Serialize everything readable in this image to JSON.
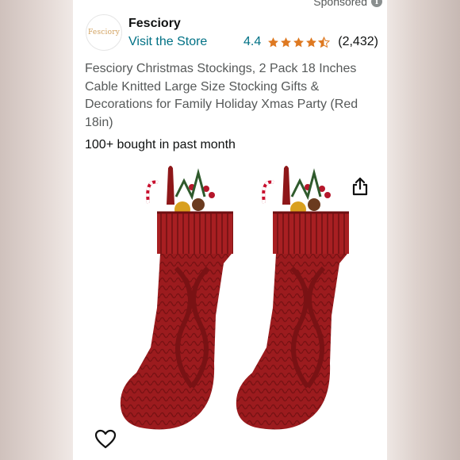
{
  "sponsored": {
    "label": "Sponsored",
    "info_icon": "info-icon"
  },
  "store": {
    "logo_text": "Fesciory",
    "brand_name": "Fesciory",
    "visit_label": "Visit the Store"
  },
  "rating": {
    "value": "4.4",
    "stars": 4.4,
    "star_color": "#de7921",
    "count": "(2,432)"
  },
  "product": {
    "title": "Fesciory Christmas Stockings, 2 Pack 18 Inches Cable Knitted Large Size Stocking Gifts & Decorations for Family Holiday Xmas Party (Red 18in)",
    "bought": "100+ bought in past month",
    "image_icon": "red-knit-stockings-image",
    "color": "#9c1b1e"
  },
  "actions": {
    "share_icon": "share-icon",
    "favorite_icon": "heart-icon"
  },
  "colors": {
    "link": "#007185",
    "text": "#0f1111",
    "muted": "#565959"
  }
}
